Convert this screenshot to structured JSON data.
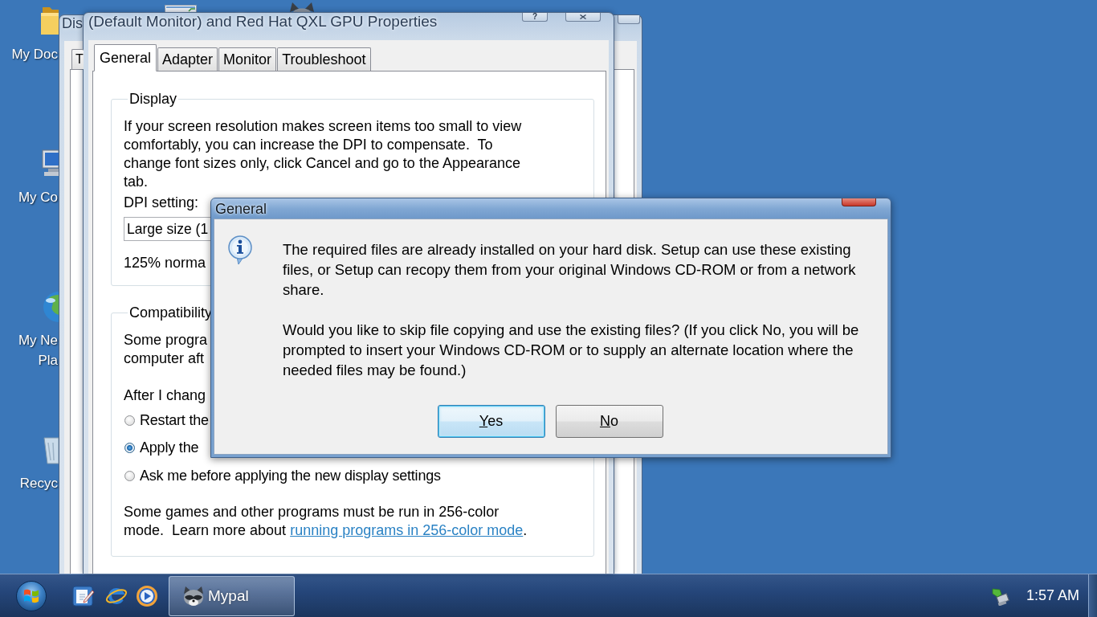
{
  "desktop_icons": [
    {
      "kind": "folder",
      "lines": [
        "My Doc"
      ]
    },
    {
      "kind": "computer",
      "lines": [
        "My Co"
      ]
    },
    {
      "kind": "network",
      "lines": [
        "My Ne",
        "Pla"
      ]
    },
    {
      "kind": "recycle_bin",
      "lines": [
        "Recyc"
      ]
    }
  ],
  "back_window": {
    "title": "Dis",
    "tabs": [
      {
        "label": "T",
        "selected": false
      }
    ]
  },
  "properties_window": {
    "title": "(Default Monitor) and Red Hat QXL GPU Properties",
    "help_glyph": "?",
    "tabs": [
      {
        "label": "General",
        "selected": true
      },
      {
        "label": "Adapter",
        "selected": false
      },
      {
        "label": "Monitor",
        "selected": false
      },
      {
        "label": "Troubleshoot",
        "selected": false
      }
    ],
    "display_group": {
      "title": "Display",
      "description": "If your screen resolution makes screen items too small to view comfortably, you can increase the DPI to compensate.  To change font sizes only, click Cancel and go to the Appearance tab.",
      "dpi_label": "DPI setting:",
      "dpi_value": "Large size (1",
      "dpi_note": "125% norma"
    },
    "compatibility_group": {
      "title": "Compatibility",
      "description_lines": [
        "Some progra",
        "computer aft"
      ],
      "options_label": "After I chang",
      "options": [
        {
          "label": "Restart the",
          "selected": false
        },
        {
          "label": "Apply the",
          "selected": true
        },
        {
          "label": "Ask me before applying the new display settings",
          "selected": false
        }
      ],
      "note": "Some games and other programs must be run in 256-color mode.  Learn more about",
      "note_link": "running programs in 256-color mode",
      "note_end": "."
    }
  },
  "dialog": {
    "title": "General",
    "paragraphs": [
      "The required files are already installed on your hard disk. Setup can use these existing files, or Setup can recopy them from your original Windows CD-ROM or from a network share.",
      "Would you like to skip file copying and use the existing files? (If you click No, you will be prompted to insert your Windows CD-ROM or to supply an alternate location where the needed files may be found.)"
    ],
    "buttons": [
      {
        "label": "Yes",
        "default": true,
        "mnemonic_underlined": true
      },
      {
        "label": "No",
        "default": false,
        "mnemonic_underlined": true
      }
    ]
  },
  "taskbar": {
    "tasks": [
      {
        "label": "Mypal"
      }
    ],
    "clock": "1:57 AM"
  }
}
